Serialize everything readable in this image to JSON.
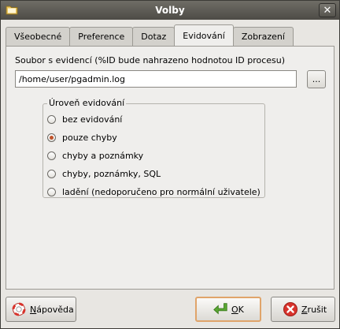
{
  "window": {
    "title": "Volby"
  },
  "tabs": [
    {
      "label": "Všeobecné"
    },
    {
      "label": "Preference"
    },
    {
      "label": "Dotaz"
    },
    {
      "label": "Evidování"
    },
    {
      "label": "Zobrazení"
    }
  ],
  "active_tab": "Evidování",
  "logfile": {
    "label": "Soubor s evidencí (%ID bude nahrazeno hodnotou ID procesu)",
    "value": "/home/user/pgadmin.log",
    "browse_label": "..."
  },
  "log_level": {
    "title": "Úroveň evidování",
    "options": [
      {
        "label": "bez evidování",
        "checked": false
      },
      {
        "label": "pouze chyby",
        "checked": true
      },
      {
        "label": "chyby a poznámky",
        "checked": false
      },
      {
        "label": "chyby, poznámky, SQL",
        "checked": false
      },
      {
        "label": "ladění (nedoporučeno pro normální uživatele)",
        "checked": false
      }
    ]
  },
  "buttons": {
    "help": {
      "mnemonic": "N",
      "rest": "ápověda"
    },
    "ok": {
      "mnemonic": "O",
      "rest": "K"
    },
    "cancel": {
      "mnemonic": "Z",
      "rest": "rušit"
    }
  },
  "colors": {
    "ok_icon": "#5aa832",
    "cancel_icon": "#d8322b",
    "radio_dot": "#c0542c"
  }
}
